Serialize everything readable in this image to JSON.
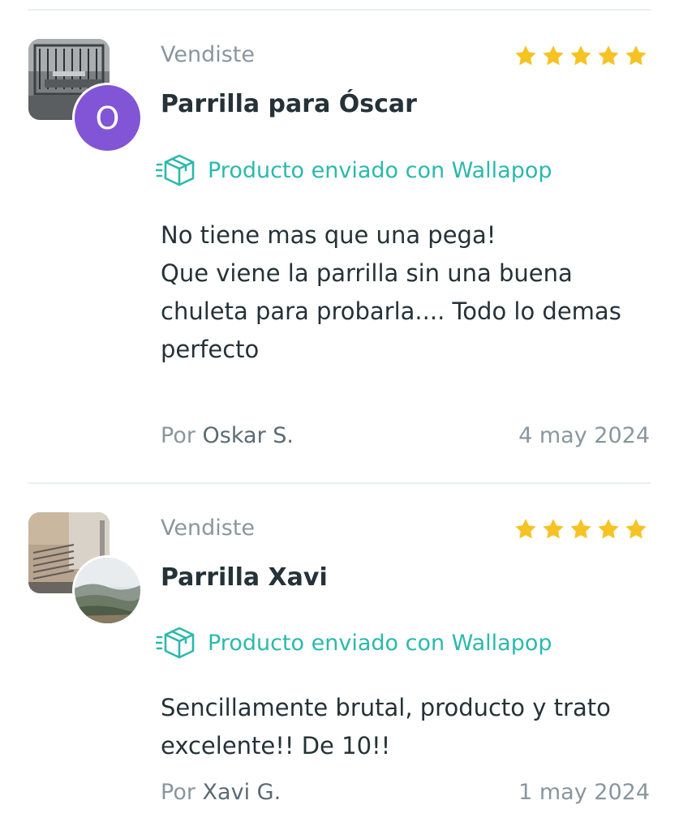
{
  "colors": {
    "accent": "#2bb9ac",
    "star": "#f6c324",
    "avatar_purple": "#8255d6",
    "text_dark": "#253238",
    "text_muted": "#8a969e"
  },
  "reviews": [
    {
      "status": "Vendiste",
      "rating": 5,
      "title": "Parrilla para Óscar",
      "shipped_label": "Producto enviado con Wallapop",
      "shipped_icon": "box-delivery-icon",
      "comment": "No tiene mas que una pega!\nQue viene la parrilla sin una buena chuleta para probarla.... Todo lo demas perfecto",
      "by_prefix": "Por",
      "author": "Oskar S.",
      "date": "4 may 2024",
      "avatar_letter": "O",
      "product_image": "grill-photo",
      "avatar_image": "letter-avatar"
    },
    {
      "status": "Vendiste",
      "rating": 5,
      "title": "Parrilla Xavi",
      "shipped_label": "Producto enviado con Wallapop",
      "shipped_icon": "box-delivery-icon",
      "comment": "Sencillamente brutal, producto y trato excelente!! De 10!!",
      "by_prefix": "Por",
      "author": "Xavi G.",
      "date": "1 may 2024",
      "avatar_letter": "",
      "product_image": "grill-photo",
      "avatar_image": "landscape-photo"
    }
  ]
}
